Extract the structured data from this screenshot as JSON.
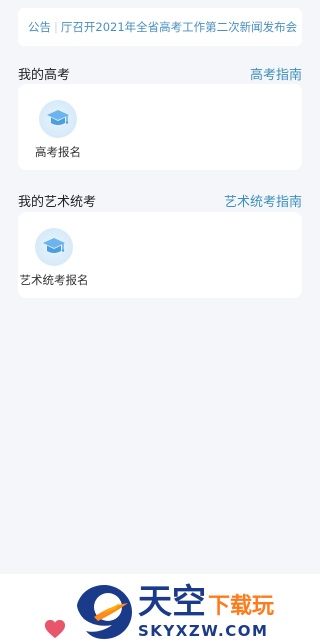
{
  "notice": {
    "prefix": "公告",
    "separator": "|",
    "text": "厅召开2021年全省高考工作第二次新闻发布会"
  },
  "gaokao": {
    "title": "我的高考",
    "link": "高考指南",
    "item": {
      "label": "高考报名",
      "icon": "graduation-cap-icon"
    }
  },
  "art": {
    "title": "我的艺术统考",
    "link": "艺术统考指南",
    "item": {
      "label": "艺术统考报名",
      "icon": "graduation-cap-icon"
    }
  },
  "watermark": {
    "big": "天空",
    "small": "下载玩",
    "domain": "SKYXZW.COM"
  },
  "colors": {
    "accent": "#3b8fbf",
    "background": "#f4f6f9",
    "heart": "#e8566b"
  }
}
